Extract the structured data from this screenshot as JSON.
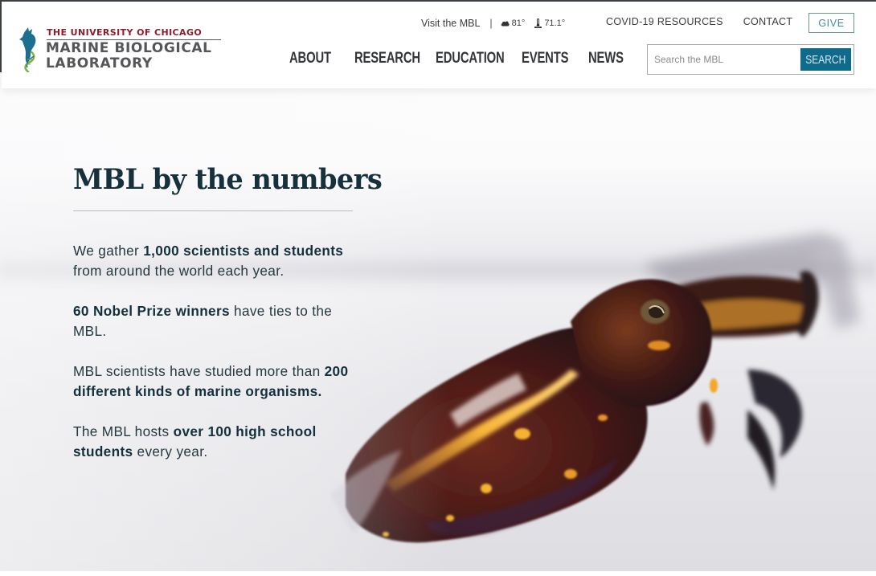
{
  "header": {
    "logo": {
      "university": "THE UNIVERSITY OF CHICAGO",
      "line1": "MARINE BIOLOGICAL",
      "line2": "LABORATORY"
    },
    "utility": {
      "visit_label": "Visit the MBL",
      "separator": "|",
      "air_temp": "81°",
      "water_temp": "71.1°",
      "links": [
        "COVID-19 RESOURCES",
        "CONTACT"
      ],
      "give_label": "GIVE"
    },
    "main_nav": [
      "ABOUT",
      "RESEARCH",
      "EDUCATION",
      "EVENTS",
      "NEWS"
    ],
    "search": {
      "placeholder": "Search the MBL",
      "value": "",
      "button_label": "SEARCH"
    }
  },
  "main": {
    "heading": "MBL by the numbers",
    "stats": [
      {
        "pre": "We gather ",
        "bold": "1,000 scientists and students",
        "post": " from around the world each year."
      },
      {
        "pre": "",
        "bold": "60 Nobel Prize winners",
        "post": " have ties to the MBL."
      },
      {
        "pre": "MBL scientists have studied more than ",
        "bold": "200 different kinds of marine organisms.",
        "post": ""
      },
      {
        "pre": "The MBL hosts ",
        "bold": "over 100 high school students",
        "post": " every year."
      }
    ],
    "hero_image": "cuttlefish swimming near the water surface"
  },
  "colors": {
    "brand_red": "#8a1f2b",
    "brand_gray": "#54565a",
    "heading": "#16303c",
    "search_button": "#0f6a8b",
    "give_border": "#6a9a8e",
    "give_text": "#3f8aa3"
  }
}
